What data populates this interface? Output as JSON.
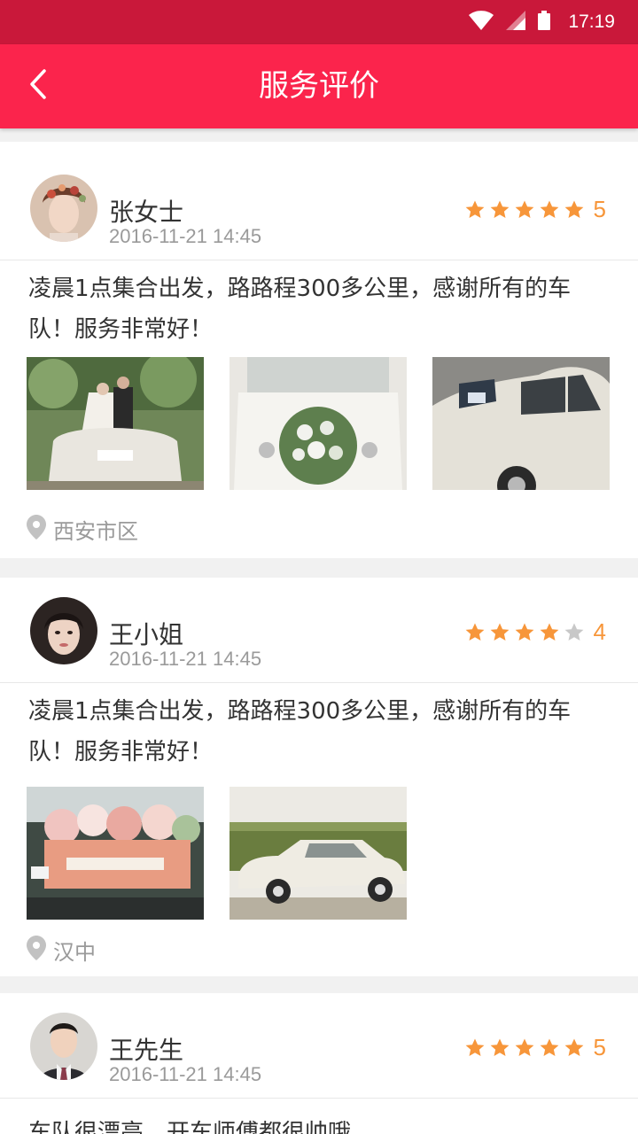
{
  "status_bar": {
    "time": "17:19"
  },
  "header": {
    "title": "服务评价",
    "back_icon": "chevron-left-icon"
  },
  "colors": {
    "status_bar": "#c9183a",
    "header": "#fb244c",
    "star_on": "#f7963a",
    "star_off": "#c8c8c8"
  },
  "reviews": [
    {
      "name": "张女士",
      "time": "2016-11-21 14:45",
      "rating": 5,
      "rating_text": "5",
      "text": "凌晨1点集合出发，路路程300多公里，感谢所有的车队！服务非常好！",
      "location": "西安市区",
      "photo_count": 3
    },
    {
      "name": "王小姐",
      "time": "2016-11-21 14:45",
      "rating": 4,
      "rating_text": "4",
      "text": "凌晨1点集合出发，路路程300多公里，感谢所有的车队！服务非常好！",
      "location": "汉中",
      "photo_count": 2
    },
    {
      "name": "王先生",
      "time": "2016-11-21 14:45",
      "rating": 5,
      "rating_text": "5",
      "text": "车队很漂亮，开车师傅都很帅哦"
    }
  ]
}
